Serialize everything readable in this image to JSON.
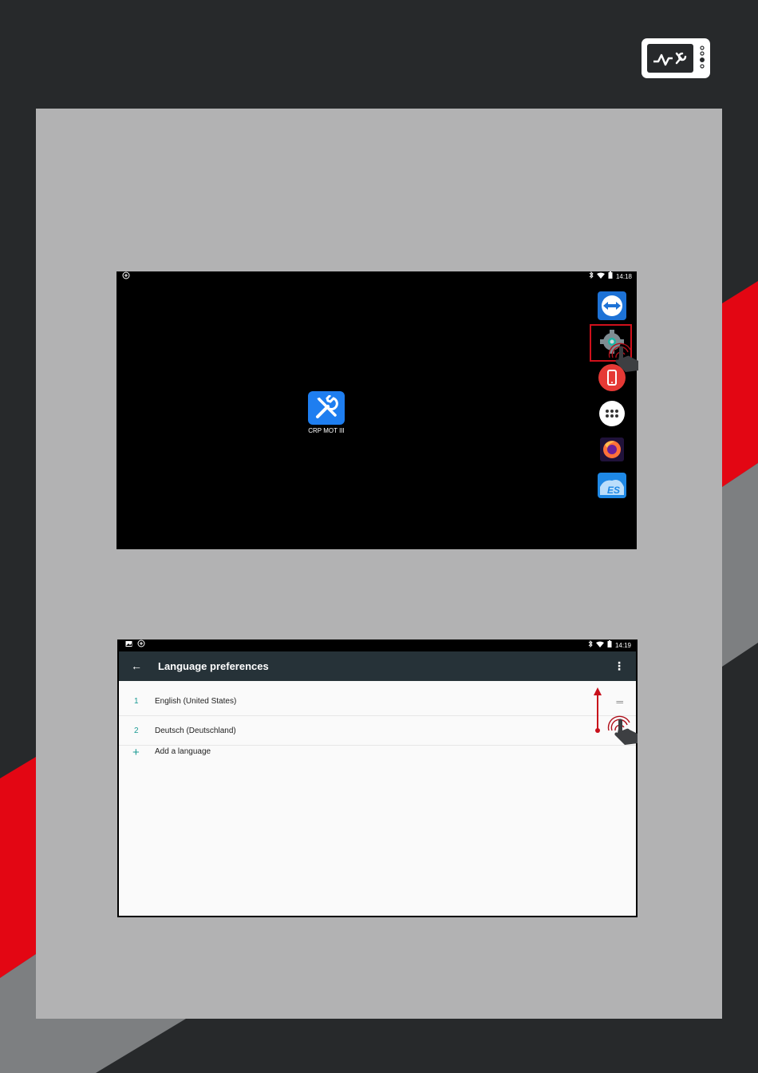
{
  "colors": {
    "background": "#27292b",
    "page": "#b2b2b3",
    "accent_red": "#e30613",
    "stripe_gray": "#7d7f81",
    "app_bar": "#263238",
    "teal": "#1a9a93",
    "crp_app_blue": "#1e7ef0"
  },
  "header": {
    "logo_icon": "diagnostic-tablet-icon"
  },
  "screenshot_home": {
    "status_time": "14:18",
    "status_icons": [
      "notification-icon",
      "bluetooth-icon",
      "wifi-icon",
      "battery-icon"
    ],
    "app_label": "CRP MOT III",
    "app_icon": "wrench-screwdriver-icon",
    "dock_apps": [
      "teamviewer-icon",
      "settings-gear-icon",
      "phone-app-icon",
      "app-drawer-icon",
      "firefox-icon",
      "es-file-explorer-icon"
    ],
    "highlighted_app": "settings-gear-icon",
    "gesture": "tap-hand-icon"
  },
  "screenshot_language": {
    "status_time": "14:19",
    "title": "Language preferences",
    "back_icon": "←",
    "menu_icon": "⋮",
    "languages": [
      {
        "num": "1",
        "name": "English (United States)"
      },
      {
        "num": "2",
        "name": "Deutsch (Deutschland)"
      }
    ],
    "drag_handle": "═",
    "add_label": "Add a language",
    "add_icon": "+",
    "gesture": "drag-up-arrow"
  }
}
